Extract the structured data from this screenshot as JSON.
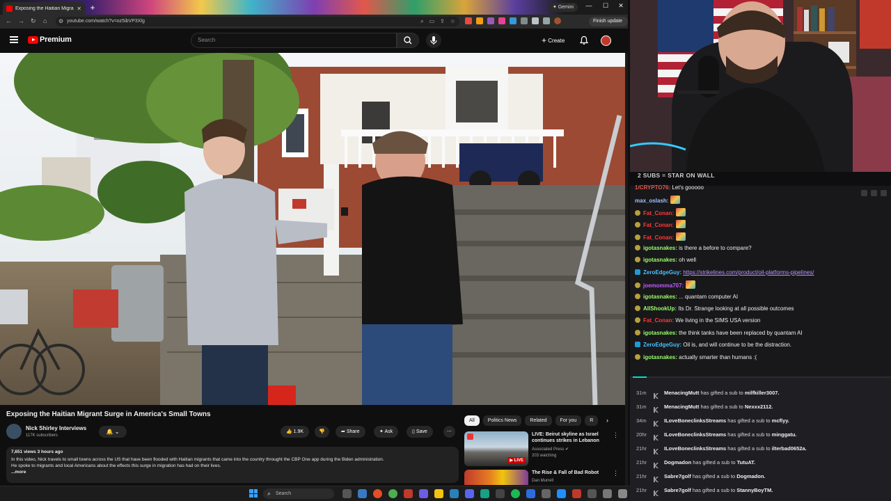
{
  "browser": {
    "tab_title": "Exposing the Haitian Migrant S",
    "gemini_label": "Gemini",
    "url": "youtube.com/watch?v=oz5ibVP3Xlg",
    "finish_update_label": "Finish update"
  },
  "youtube": {
    "brand": "Premium",
    "search_placeholder": "Search",
    "create_label": "Create",
    "video_title": "Exposing the Haitian Migrant Surge in America's Small Towns",
    "channel_name": "Nick Shirley Interviews",
    "channel_subs": "117K subscribers",
    "like_count": "1.9K",
    "share_label": "Share",
    "ask_label": "Ask",
    "save_label": "Save",
    "description_meta": "7,651 views  3 hours ago",
    "description_line1": "In this video, Nick travels to small towns across the US that have been flooded with Haitian migrants that came into the country throught the CBP One app during the Biden administration.",
    "description_line2": "He spoke to migrants and local Americans about the effects this surge in migration has had on their lives.",
    "description_more": "...more",
    "chips": [
      "All",
      "Politics News",
      "Related",
      "For you",
      "R"
    ],
    "recommendations": [
      {
        "title": "LIVE: Beirut skyline as Israel continues strikes in Lebanon",
        "channel": "Associated Press",
        "meta": "203 watching",
        "badge": "LIVE"
      },
      {
        "title": "The Rise & Fall of Bad Robot",
        "channel": "Dan Murrell",
        "meta": "",
        "badge": ""
      }
    ]
  },
  "taskbar": {
    "search_placeholder": "Search"
  },
  "chat": {
    "banner": "2 SUBS = STAR ON WALL",
    "messages": [
      {
        "user": "1/CRYPTO76",
        "text": "Let's gooooo",
        "color": "#e2574c",
        "emote": false,
        "link": ""
      },
      {
        "user": "max_oslash",
        "text": "",
        "color": "#9ec2ff",
        "emote": true,
        "link": ""
      },
      {
        "user": "Fat_Conan",
        "text": "",
        "color": "#ff3b3b",
        "emote": true,
        "link": ""
      },
      {
        "user": "Fat_Conan",
        "text": "",
        "color": "#ff3b3b",
        "emote": true,
        "link": ""
      },
      {
        "user": "Fat_Conan",
        "text": "",
        "color": "#ff3b3b",
        "emote": true,
        "link": ""
      },
      {
        "user": "igotasnakes",
        "text": "is there a before to compare?",
        "color": "#9bff6a",
        "emote": false,
        "link": ""
      },
      {
        "user": "igotasnakes",
        "text": "oh well",
        "color": "#9bff6a",
        "emote": false,
        "link": ""
      },
      {
        "user": "ZeroEdgeGuy",
        "text": "",
        "color": "#4cc2ff",
        "emote": false,
        "link": "https://strikelines.com/product/oil-platforms-pipelines/"
      },
      {
        "user": "joemomma707",
        "text": "",
        "color": "#c45bff",
        "emote": true,
        "link": ""
      },
      {
        "user": "igotasnakes",
        "text": "... quantam computer AI",
        "color": "#9bff6a",
        "emote": false,
        "link": ""
      },
      {
        "user": "AllShookUp",
        "text": "Its Dr. Strange looking at all possible outcomes",
        "color": "#9bff6a",
        "emote": false,
        "link": ""
      },
      {
        "user": "Fat_Conan",
        "text": "We living in the SIMS USA version",
        "color": "#ff3b3b",
        "emote": false,
        "link": ""
      },
      {
        "user": "igotasnakes",
        "text": "the think tanks have been replaced by quantam AI",
        "color": "#9bff6a",
        "emote": false,
        "link": ""
      },
      {
        "user": "ZeroEdgeGuy",
        "text": "Oil is, and will continue to be the distraction.",
        "color": "#4cc2ff",
        "emote": false,
        "link": ""
      },
      {
        "user": "igotasnakes",
        "text": "actually smarter than humans :(",
        "color": "#9bff6a",
        "emote": false,
        "link": ""
      }
    ],
    "events": [
      {
        "time": "31m",
        "from": "MenacingMutt",
        "mid": "has gifted a sub to",
        "to": "milfkiller3007."
      },
      {
        "time": "31m",
        "from": "MenacingMutt",
        "mid": "has gifted a sub to",
        "to": "Nexxx2112."
      },
      {
        "time": "34m",
        "from": "ILoveBoneclinksStreams",
        "mid": "has gifted a sub to",
        "to": "mcflyy."
      },
      {
        "time": "20hr",
        "from": "ILoveBoneclinksStreams",
        "mid": "has gifted a sub to",
        "to": "minggatu."
      },
      {
        "time": "21hr",
        "from": "ILoveBoneclinksStreams",
        "mid": "has gifted a sub to",
        "to": "ilterbad0652a."
      },
      {
        "time": "21hr",
        "from": "Dogmadon",
        "mid": "has gifted a sub to",
        "to": "TutuAT."
      },
      {
        "time": "21hr",
        "from": "Sabre7golf",
        "mid": "has gifted a sub to",
        "to": "Dogmadon."
      },
      {
        "time": "21hr",
        "from": "Sabre7golf",
        "mid": "has gifted a sub to",
        "to": "StannyBoyTM."
      }
    ]
  }
}
